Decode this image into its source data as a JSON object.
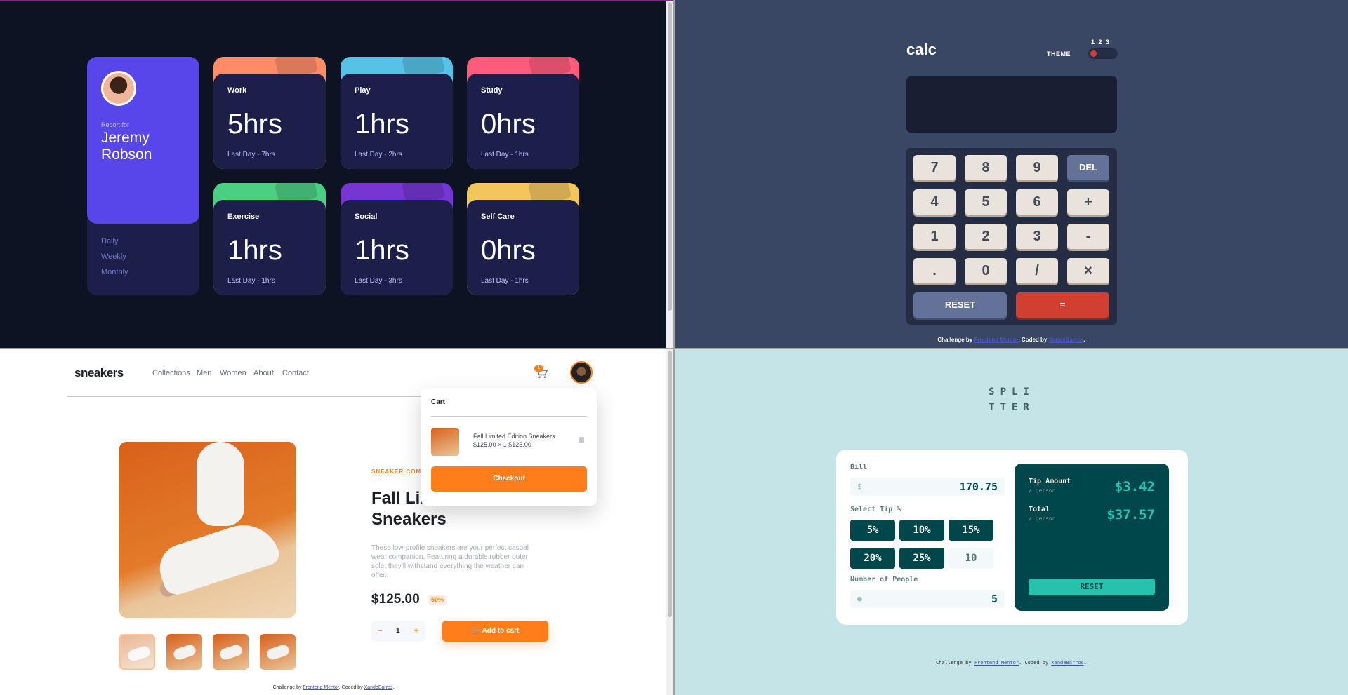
{
  "tracker": {
    "report_for": "Report for",
    "name": "Jeremy Robson",
    "periods": [
      "Daily",
      "Weekly",
      "Monthly"
    ],
    "cards": [
      {
        "title": "Work",
        "hours": "5hrs",
        "last": "Last Day - 7hrs",
        "color": "#ff8c66"
      },
      {
        "title": "Play",
        "hours": "1hrs",
        "last": "Last Day - 2hrs",
        "color": "#56c2e6"
      },
      {
        "title": "Study",
        "hours": "0hrs",
        "last": "Last Day - 1hrs",
        "color": "#ff5c7c"
      },
      {
        "title": "Exercise",
        "hours": "1hrs",
        "last": "Last Day - 1hrs",
        "color": "#4bcf83"
      },
      {
        "title": "Social",
        "hours": "1hrs",
        "last": "Last Day - 3hrs",
        "color": "#7536d3"
      },
      {
        "title": "Self Care",
        "hours": "0hrs",
        "last": "Last Day - 1hrs",
        "color": "#f1c65b"
      }
    ]
  },
  "calc": {
    "logo": "calc",
    "theme_label": "THEME",
    "theme_numbers": "1 2 3",
    "display": "",
    "keys": [
      {
        "label": "7"
      },
      {
        "label": "8"
      },
      {
        "label": "9"
      },
      {
        "label": "DEL",
        "kind": "blue"
      },
      {
        "label": "4"
      },
      {
        "label": "5"
      },
      {
        "label": "6"
      },
      {
        "label": "+"
      },
      {
        "label": "1"
      },
      {
        "label": "2"
      },
      {
        "label": "3"
      },
      {
        "label": "-"
      },
      {
        "label": "."
      },
      {
        "label": "0"
      },
      {
        "label": "/"
      },
      {
        "label": "×"
      }
    ],
    "reset": "RESET",
    "equals": "=",
    "credit_prefix": "Challenge by ",
    "credit_link1": "Frontend Mentor",
    "credit_mid": ". Coded by ",
    "credit_link2": "XandeBarros",
    "credit_suffix": "."
  },
  "sneakers": {
    "logo": "sneakers",
    "nav": [
      "Collections",
      "Men",
      "Women",
      "About",
      "Contact"
    ],
    "cart_count": "1",
    "company": "SNEAKER COMPANY",
    "title": "Fall Limited Edition Sneakers",
    "description": "These low-profile sneakers are your perfect casual wear companion. Featuring a durable rubber outer sole, they'll withstand everything the weather can offer.",
    "price": "$125.00",
    "discount": "50%",
    "quantity": "1",
    "minus": "−",
    "plus": "+",
    "add_to_cart": "Add to cart",
    "cart": {
      "title": "Cart",
      "item_name": "Fall Limited Edition Sneakers",
      "item_summary": "$125.00 × 1 $125.00",
      "checkout": "Checkout"
    },
    "credit_prefix": "Challenge by ",
    "credit_link1": "Frontend Mentor",
    "credit_mid": ". Coded by ",
    "credit_link2": "XandeBarros",
    "credit_suffix": "."
  },
  "splitter": {
    "logo_line1": "SPLI",
    "logo_line2": "TTER",
    "bill_label": "Bill",
    "bill_icon": "$",
    "bill_value": "170.75",
    "tip_label": "Select Tip %",
    "tips": [
      "5%",
      "10%",
      "15%",
      "20%",
      "25%"
    ],
    "custom_tip": "10",
    "people_label": "Number of People",
    "people_value": "5",
    "tip_amount_label": "Tip Amount",
    "tip_amount_value": "$3.42",
    "total_label": "Total",
    "total_value": "$37.57",
    "per_person": "/ person",
    "reset": "RESET",
    "credit_prefix": "Challenge by ",
    "credit_link1": "Frontend Mentor",
    "credit_mid": ". Coded by ",
    "credit_link2": "XandeBarros",
    "credit_suffix": "."
  }
}
